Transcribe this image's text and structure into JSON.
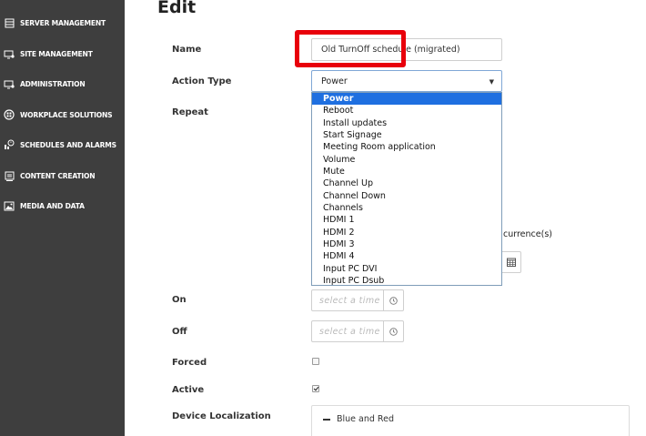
{
  "sidebar": {
    "items": [
      {
        "label": "SERVER MANAGEMENT",
        "icon": "server-icon"
      },
      {
        "label": "SITE MANAGEMENT",
        "icon": "site-icon"
      },
      {
        "label": "ADMINISTRATION",
        "icon": "admin-icon"
      },
      {
        "label": "WORKPLACE SOLUTIONS",
        "icon": "workplace-icon"
      },
      {
        "label": "SCHEDULES AND ALARMS",
        "icon": "schedule-icon"
      },
      {
        "label": "CONTENT CREATION",
        "icon": "content-icon"
      },
      {
        "label": "MEDIA AND DATA",
        "icon": "media-icon"
      }
    ]
  },
  "page": {
    "title": "Edit"
  },
  "form": {
    "name_label": "Name",
    "name_value": "Old TurnOff schedule (migrated)",
    "action_type_label": "Action Type",
    "action_type_value": "Power",
    "repeat_label": "Repeat",
    "occurrence_text": "currence(s)",
    "on_label": "On",
    "on_placeholder": "select a time",
    "off_label": "Off",
    "off_placeholder": "select a time",
    "forced_label": "Forced",
    "forced_checked": false,
    "active_label": "Active",
    "active_checked": true,
    "device_loc_label": "Device Localization",
    "device_loc_item": "Blue and Red"
  },
  "dropdown": {
    "selected_index": 0,
    "options": [
      "Power",
      "Reboot",
      "Install updates",
      "Start Signage",
      "Meeting Room application",
      "Volume",
      "Mute",
      "Channel Up",
      "Channel Down",
      "Channels",
      "HDMI 1",
      "HDMI 2",
      "HDMI 3",
      "HDMI 4",
      "Input PC DVI",
      "Input PC Dsub"
    ]
  },
  "colors": {
    "sidebar_bg": "#3e3e3e",
    "highlight": "#e8000b",
    "selected_option": "#1e6fe0"
  }
}
